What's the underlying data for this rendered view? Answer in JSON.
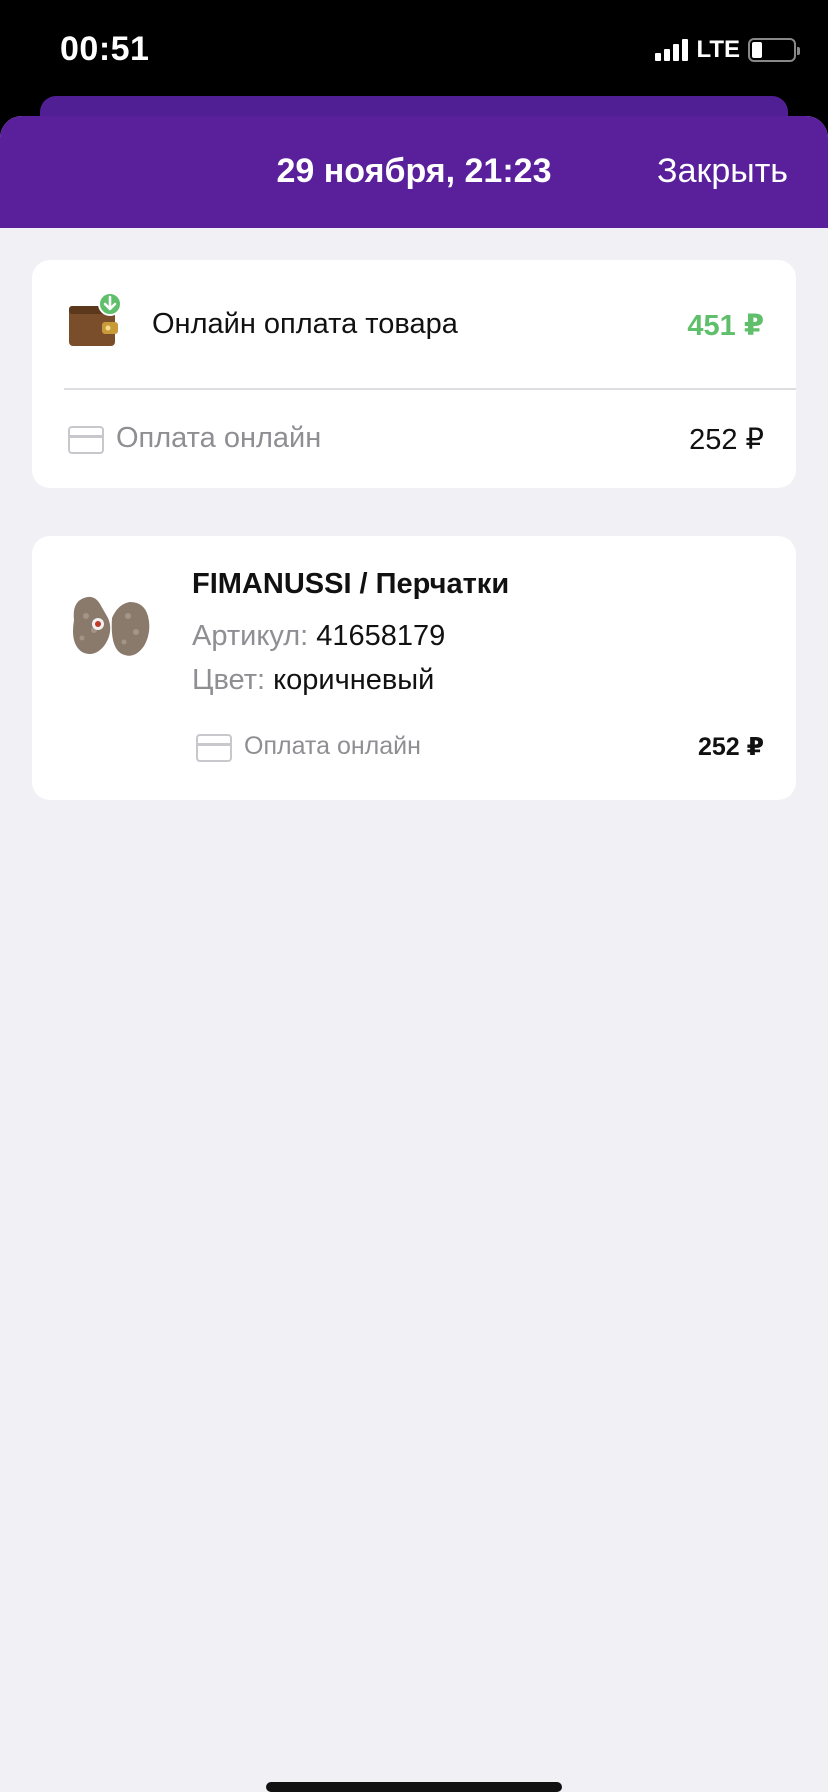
{
  "status_bar": {
    "time": "00:51",
    "network": "LTE",
    "icons": [
      "signal-icon",
      "battery-icon"
    ]
  },
  "header": {
    "title": "29 ноября, 21:23",
    "close_label": "Закрыть",
    "color": "#5a209c"
  },
  "payment": {
    "title": "Онлайн оплата товара",
    "amount": "451 ₽",
    "amount_color": "#5fbf6a",
    "icon": "wallet-icon",
    "method": {
      "label": "Оплата онлайн",
      "amount": "252 ₽",
      "icon": "credit-card-icon"
    }
  },
  "item": {
    "name": "FIMANUSSI / Перчатки",
    "sku_label": "Артикул:",
    "sku_value": "41658179",
    "color_label": "Цвет:",
    "color_value": "коричневый",
    "thumbnail": "gloves-image",
    "payment_label": "Оплата онлайн",
    "payment_amount": "252 ₽"
  }
}
